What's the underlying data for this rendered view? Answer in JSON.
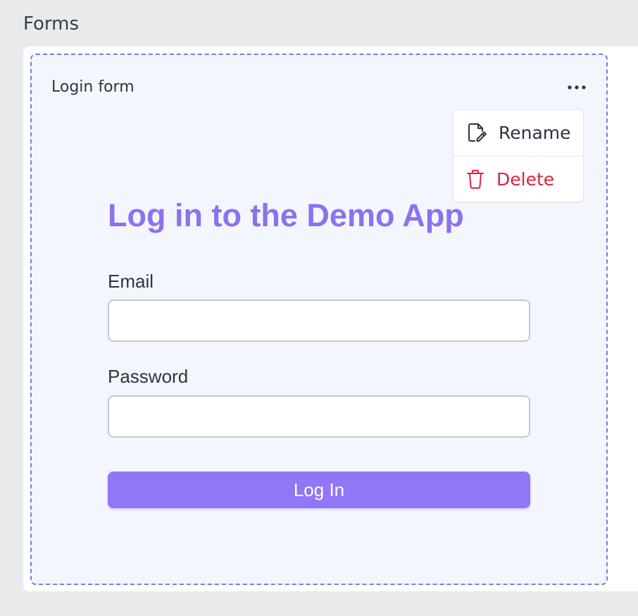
{
  "section": {
    "title": "Forms"
  },
  "card": {
    "title": "Login form",
    "menu": {
      "trigger_icon": "more-horizontal-icon",
      "items": [
        {
          "label": "Rename",
          "icon": "file-edit-icon",
          "color": "#2d3442"
        },
        {
          "label": "Delete",
          "icon": "trash-icon",
          "color": "#d7263d"
        }
      ]
    }
  },
  "form": {
    "heading": "Log in to the Demo App",
    "fields": [
      {
        "label": "Email",
        "value": "",
        "placeholder": ""
      },
      {
        "label": "Password",
        "value": "",
        "placeholder": ""
      }
    ],
    "submit_label": "Log In"
  },
  "colors": {
    "background": "#e9eaec",
    "card_background": "#f4f6fd",
    "card_border": "#6c82e6",
    "accent": "#9176f5",
    "heading": "#8b72ee",
    "danger": "#d7263d"
  }
}
